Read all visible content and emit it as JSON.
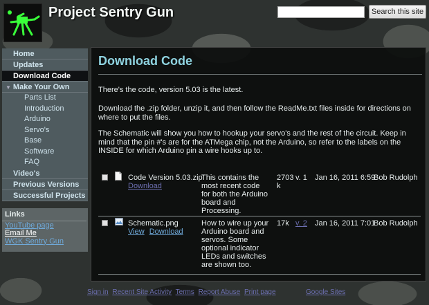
{
  "site": {
    "title": "Project Sentry Gun",
    "logo_icon": "sentry-gun-logo-icon"
  },
  "search": {
    "value": "",
    "button_label": "Search this site"
  },
  "sidebar": {
    "items": [
      {
        "label": "Home"
      },
      {
        "label": "Updates"
      },
      {
        "label": "Download Code",
        "active": true
      },
      {
        "label": "Make Your Own",
        "expanded": true
      },
      {
        "label": "Video's"
      },
      {
        "label": "Previous Versions"
      },
      {
        "label": "Successful Projects"
      }
    ],
    "subitems": [
      "Parts List",
      "Introduction",
      "Arduino",
      "Servo's",
      "Base",
      "Software",
      "FAQ"
    ],
    "links": {
      "heading": "Links",
      "items": [
        "YouTube page",
        "Email Me",
        "WGK Sentry Gun"
      ]
    }
  },
  "main": {
    "title": "Download Code",
    "paragraphs": [
      "There's the code, version 5.03 is the latest.",
      "Download the .zip folder, unzip it, and then follow the ReadMe.txt files inside for directions on where to put the files.",
      "The Schematic will show you how to hookup your servo's and the rest of the circuit. Keep in mind that the pin #'s are for the ATMega chip, not the Arduino, so refer to the labels on the INSIDE for which Arduino pin a wire hooks up to."
    ],
    "files": [
      {
        "name": "Code Version 5.03.zip",
        "download_label": "Download",
        "description": "This contains the most recent code for both the Arduino board and Processing.",
        "size": "2703 k",
        "version": "v. 1",
        "date": "Jan 16, 2011 6:59",
        "author": "Bob Rudolph"
      },
      {
        "name": "Schematic.png",
        "view_label": "View",
        "download_label": "Download",
        "description": "How to wire up your Arduino board and servos. Some optional indicator LEDs and switches are shown too.",
        "size": "17k",
        "version": "v. 2",
        "date": "Jan 16, 2011 7:01",
        "author": "Bob Rudolph"
      }
    ]
  },
  "footer": {
    "links": [
      "Sign in",
      "Recent Site Activity",
      "Terms",
      "Report Abuse",
      "Print page"
    ],
    "powered": "Google Sites"
  }
}
